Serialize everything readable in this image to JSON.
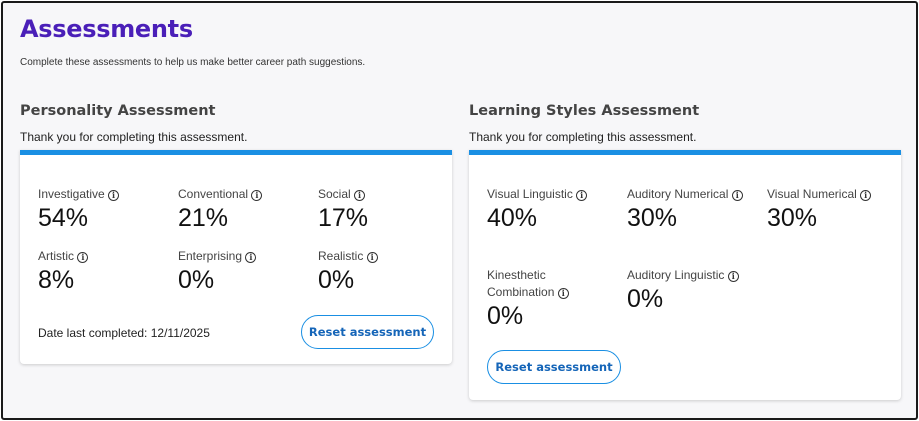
{
  "page": {
    "title": "Assessments",
    "subtitle": "Complete these assessments to help us make better career path suggestions."
  },
  "personality": {
    "title": "Personality Assessment",
    "note": "Thank you for completing this assessment.",
    "metrics": [
      {
        "label": "Investigative",
        "value": "54%"
      },
      {
        "label": "Conventional",
        "value": "21%"
      },
      {
        "label": "Social",
        "value": "17%"
      },
      {
        "label": "Artistic",
        "value": "8%"
      },
      {
        "label": "Enterprising",
        "value": "0%"
      },
      {
        "label": "Realistic",
        "value": "0%"
      }
    ],
    "date_completed": "Date last completed: 12/11/2025",
    "reset_label": "Reset assessment"
  },
  "learning": {
    "title": "Learning Styles Assessment",
    "note": "Thank you for completing this assessment.",
    "metrics": [
      {
        "label": "Visual Linguistic",
        "value": "40%"
      },
      {
        "label": "Auditory Numerical",
        "value": "30%"
      },
      {
        "label": "Visual Numerical",
        "value": "30%"
      },
      {
        "label": "Kinesthetic Combination",
        "value": "0%"
      },
      {
        "label": "Auditory Linguistic",
        "value": "0%"
      }
    ],
    "reset_label": "Reset assessment"
  },
  "icons": {
    "info": "info-icon",
    "info_glyph": "i"
  },
  "colors": {
    "title": "#4a1fb8",
    "accent": "#1a8fe3",
    "button_text": "#1565b8"
  }
}
